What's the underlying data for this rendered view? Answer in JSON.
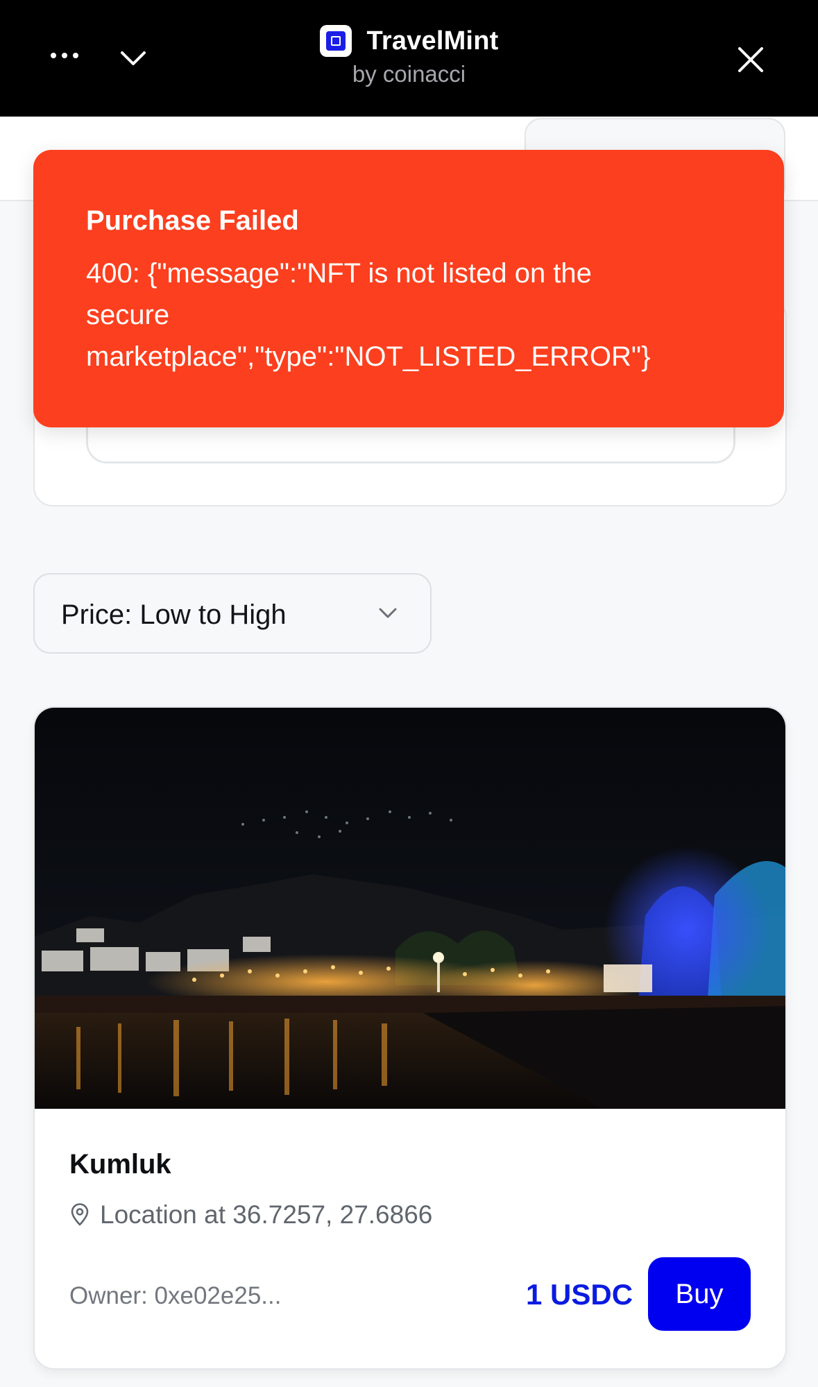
{
  "app": {
    "name": "TravelMint",
    "subtitle": "by coinacci",
    "menu_icon": "more-dots-icon",
    "collapse_icon": "chevron-down-icon",
    "close_icon": "close-icon"
  },
  "toast": {
    "title": "Purchase Failed",
    "message": "400: {\"message\":\"NFT is not listed on the\nsecure\nmarketplace\",\"type\":\"NOT_LISTED_ERROR\"}",
    "color": "#fc3f1e"
  },
  "sort": {
    "selected": "Price: Low to High"
  },
  "listing": {
    "name": "Kumluk",
    "location": "Location at 36.7257, 27.6866",
    "owner": "Owner: 0xe02e25...",
    "price": "1 USDC",
    "buy_label": "Buy",
    "image_alt": "Night waterfront with lights reflecting on the sea"
  },
  "colors": {
    "accent": "#0000f0",
    "price": "#0a1be0",
    "topbar": "#000000"
  }
}
